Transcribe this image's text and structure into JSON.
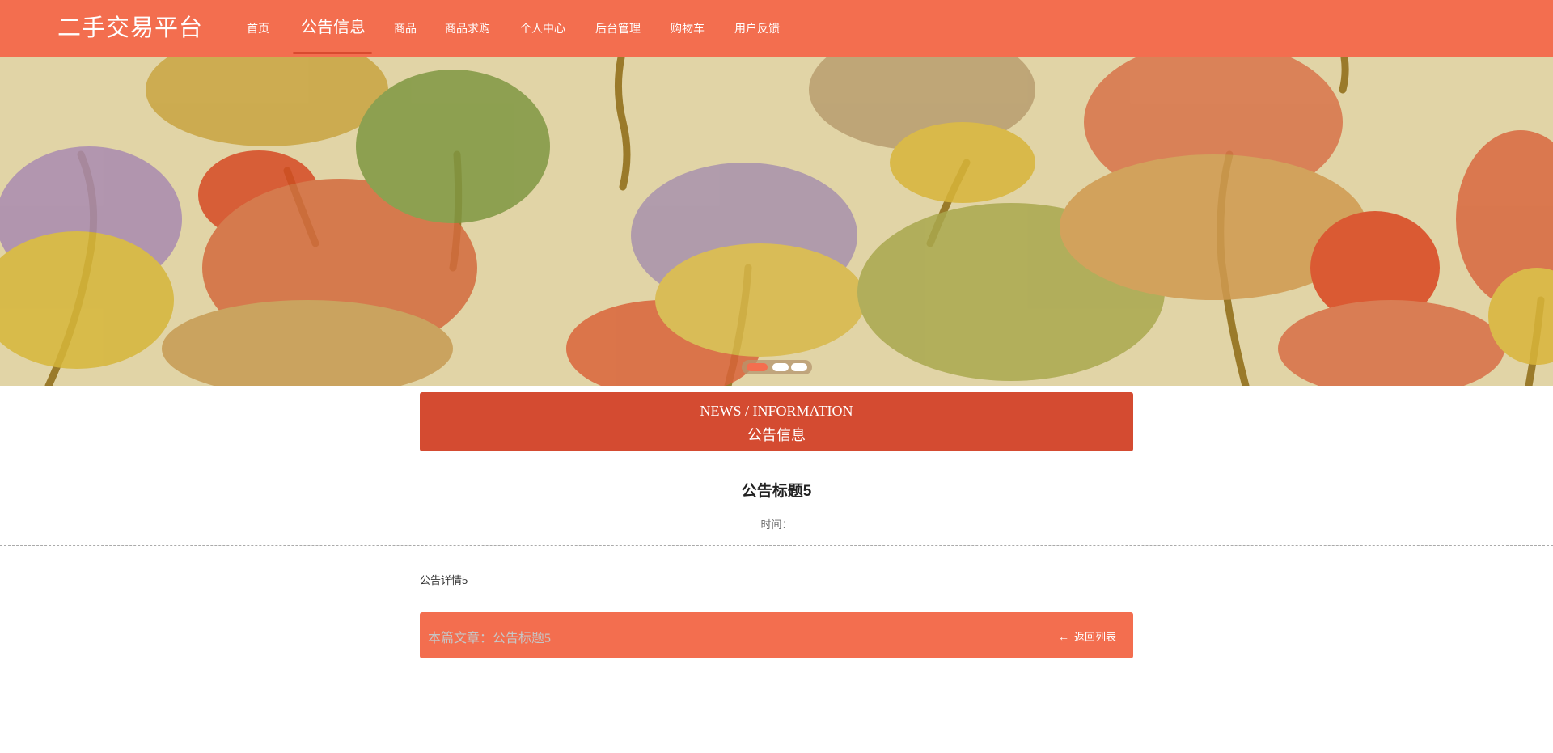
{
  "header": {
    "logo": "二手交易平台",
    "nav": [
      {
        "label": "首页",
        "active": false
      },
      {
        "label": "公告信息",
        "active": true
      },
      {
        "label": "商品",
        "active": false
      },
      {
        "label": "商品求购",
        "active": false
      },
      {
        "label": "个人中心",
        "active": false
      },
      {
        "label": "后台管理",
        "active": false
      },
      {
        "label": "购物车",
        "active": false
      },
      {
        "label": "用户反馈",
        "active": false
      }
    ]
  },
  "banner": {
    "dots": 3,
    "active_dot": 0
  },
  "section": {
    "title_en": "NEWS / INFORMATION",
    "title_cn": "公告信息"
  },
  "article": {
    "title": "公告标题5",
    "time_label": "时间：",
    "content": "公告详情5"
  },
  "bar": {
    "label": "本篇文章：公告标题5",
    "back_label": "返回列表",
    "back_icon": "arrow-left-icon"
  },
  "colors": {
    "primary": "#f36e4f",
    "section": "#d44b31",
    "banner_bg": "#e1d4a6"
  }
}
